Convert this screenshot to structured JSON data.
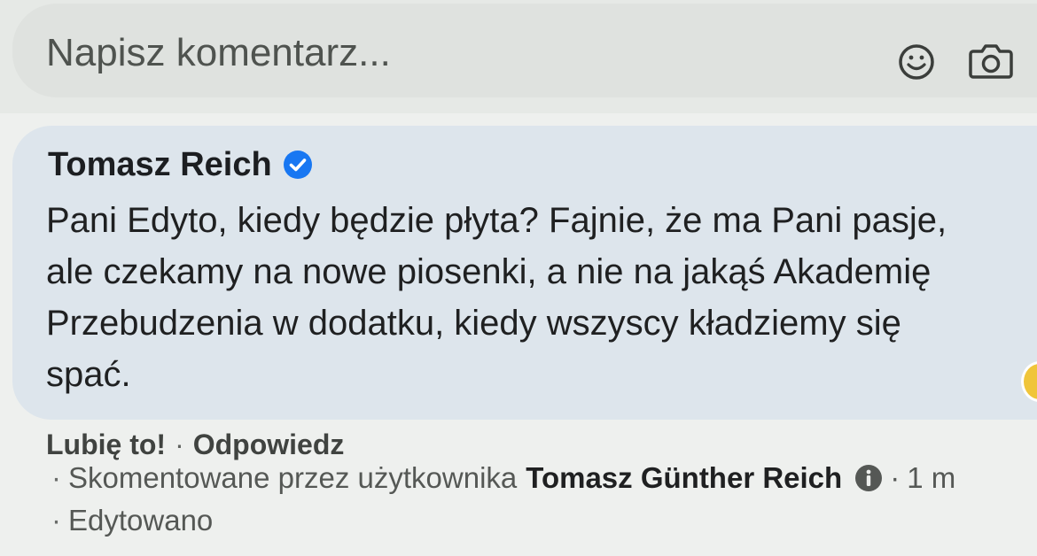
{
  "composer": {
    "placeholder": "Napisz komentarz...",
    "emoji_icon": "smiley-face-icon",
    "camera_icon": "camera-icon"
  },
  "comment": {
    "author": "Tomasz Reich",
    "verified_icon": "verified-checkmark-icon",
    "text": "Pani Edyto, kiedy będzie płyta? Fajnie, że ma Pani pasje, ale czekamy na nowe piosenki, a nie na jakąś Akademię Przebudzenia w dodatku, kiedy wszyscy kładziemy się spać.",
    "actions": {
      "like": "Lubię to!",
      "separator": "·",
      "reply": "Odpowiedz"
    },
    "meta": {
      "dot": "·",
      "commented_by_prefix": "Skomentowane przez użytkownika",
      "commented_by_name": "Tomasz Günther Reich",
      "info_icon": "info-circle-icon",
      "time_separator": "·",
      "time": "1 m",
      "edited": "Edytowano"
    }
  },
  "colors": {
    "accent_verified": "#1877f2",
    "bubble": "#dde5ec",
    "input": "#dfe2df"
  }
}
